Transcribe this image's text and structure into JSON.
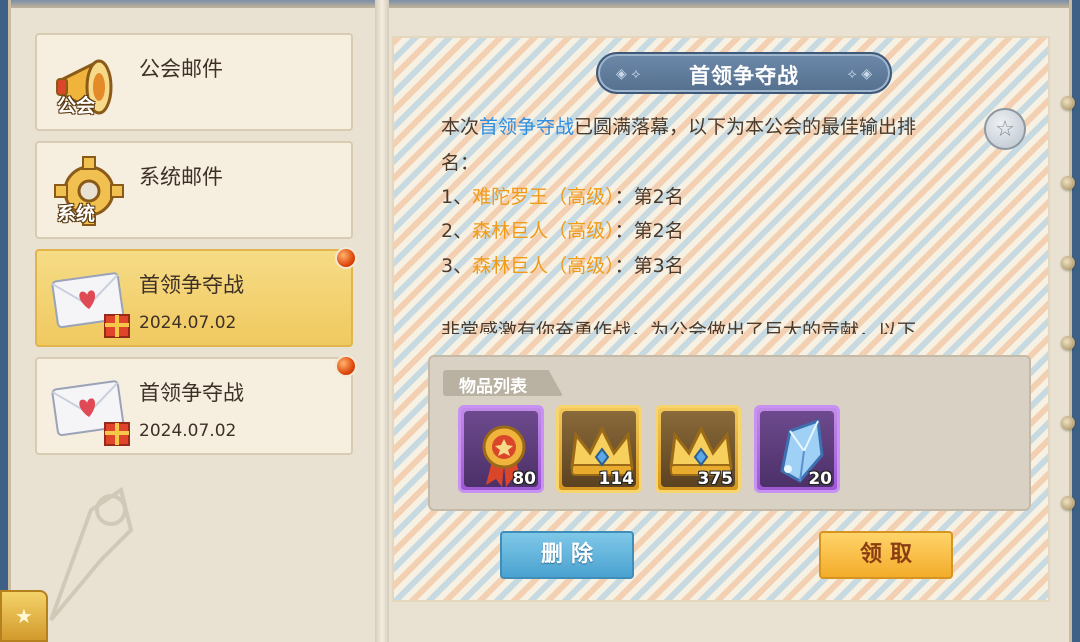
{
  "mail_list": [
    {
      "title": "公会邮件",
      "icon_caption": "公会",
      "icon": "megaphone-icon",
      "date": "",
      "selected": false,
      "unread": false
    },
    {
      "title": "系统邮件",
      "icon_caption": "系统",
      "icon": "gear-icon",
      "date": "",
      "selected": false,
      "unread": false
    },
    {
      "title": "首领争夺战",
      "icon_caption": "",
      "icon": "envelope-gift-icon",
      "date": "2024.07.02",
      "selected": true,
      "unread": true
    },
    {
      "title": "首领争夺战",
      "icon_caption": "",
      "icon": "envelope-gift-icon",
      "date": "2024.07.02",
      "selected": false,
      "unread": true
    }
  ],
  "detail": {
    "title": "首领争夺战",
    "line1": {
      "prefix": "本次",
      "highlight": "首领争夺战",
      "suffix": "已圆满落幕，以下为本公会的最佳输出排"
    },
    "line2": "名：",
    "rankings": [
      {
        "index": "1、",
        "boss": "难陀罗王（高级）",
        "sep": "：",
        "rank": "第2名"
      },
      {
        "index": "2、",
        "boss": "森林巨人（高级）",
        "sep": "：",
        "rank": "第2名"
      },
      {
        "index": "3、",
        "boss": "森林巨人（高级）",
        "sep": "：",
        "rank": "第3名"
      }
    ],
    "partial_line": "非常感激有你奋勇作战，为公会做出了巨大的贡献，以下",
    "items_label": "物品列表",
    "items": [
      {
        "icon": "medal-icon",
        "count": "80",
        "rarity": "purple"
      },
      {
        "icon": "crown-icon",
        "count": "114",
        "rarity": "gold"
      },
      {
        "icon": "crown-icon",
        "count": "375",
        "rarity": "gold"
      },
      {
        "icon": "crystal-shard-icon",
        "count": "20",
        "rarity": "purple"
      }
    ],
    "delete_label": "删除",
    "claim_label": "领取"
  },
  "colors": {
    "highlight_blue": "#2f8ee0",
    "highlight_orange": "#f09a16",
    "selected_bg": "#f0c960"
  }
}
